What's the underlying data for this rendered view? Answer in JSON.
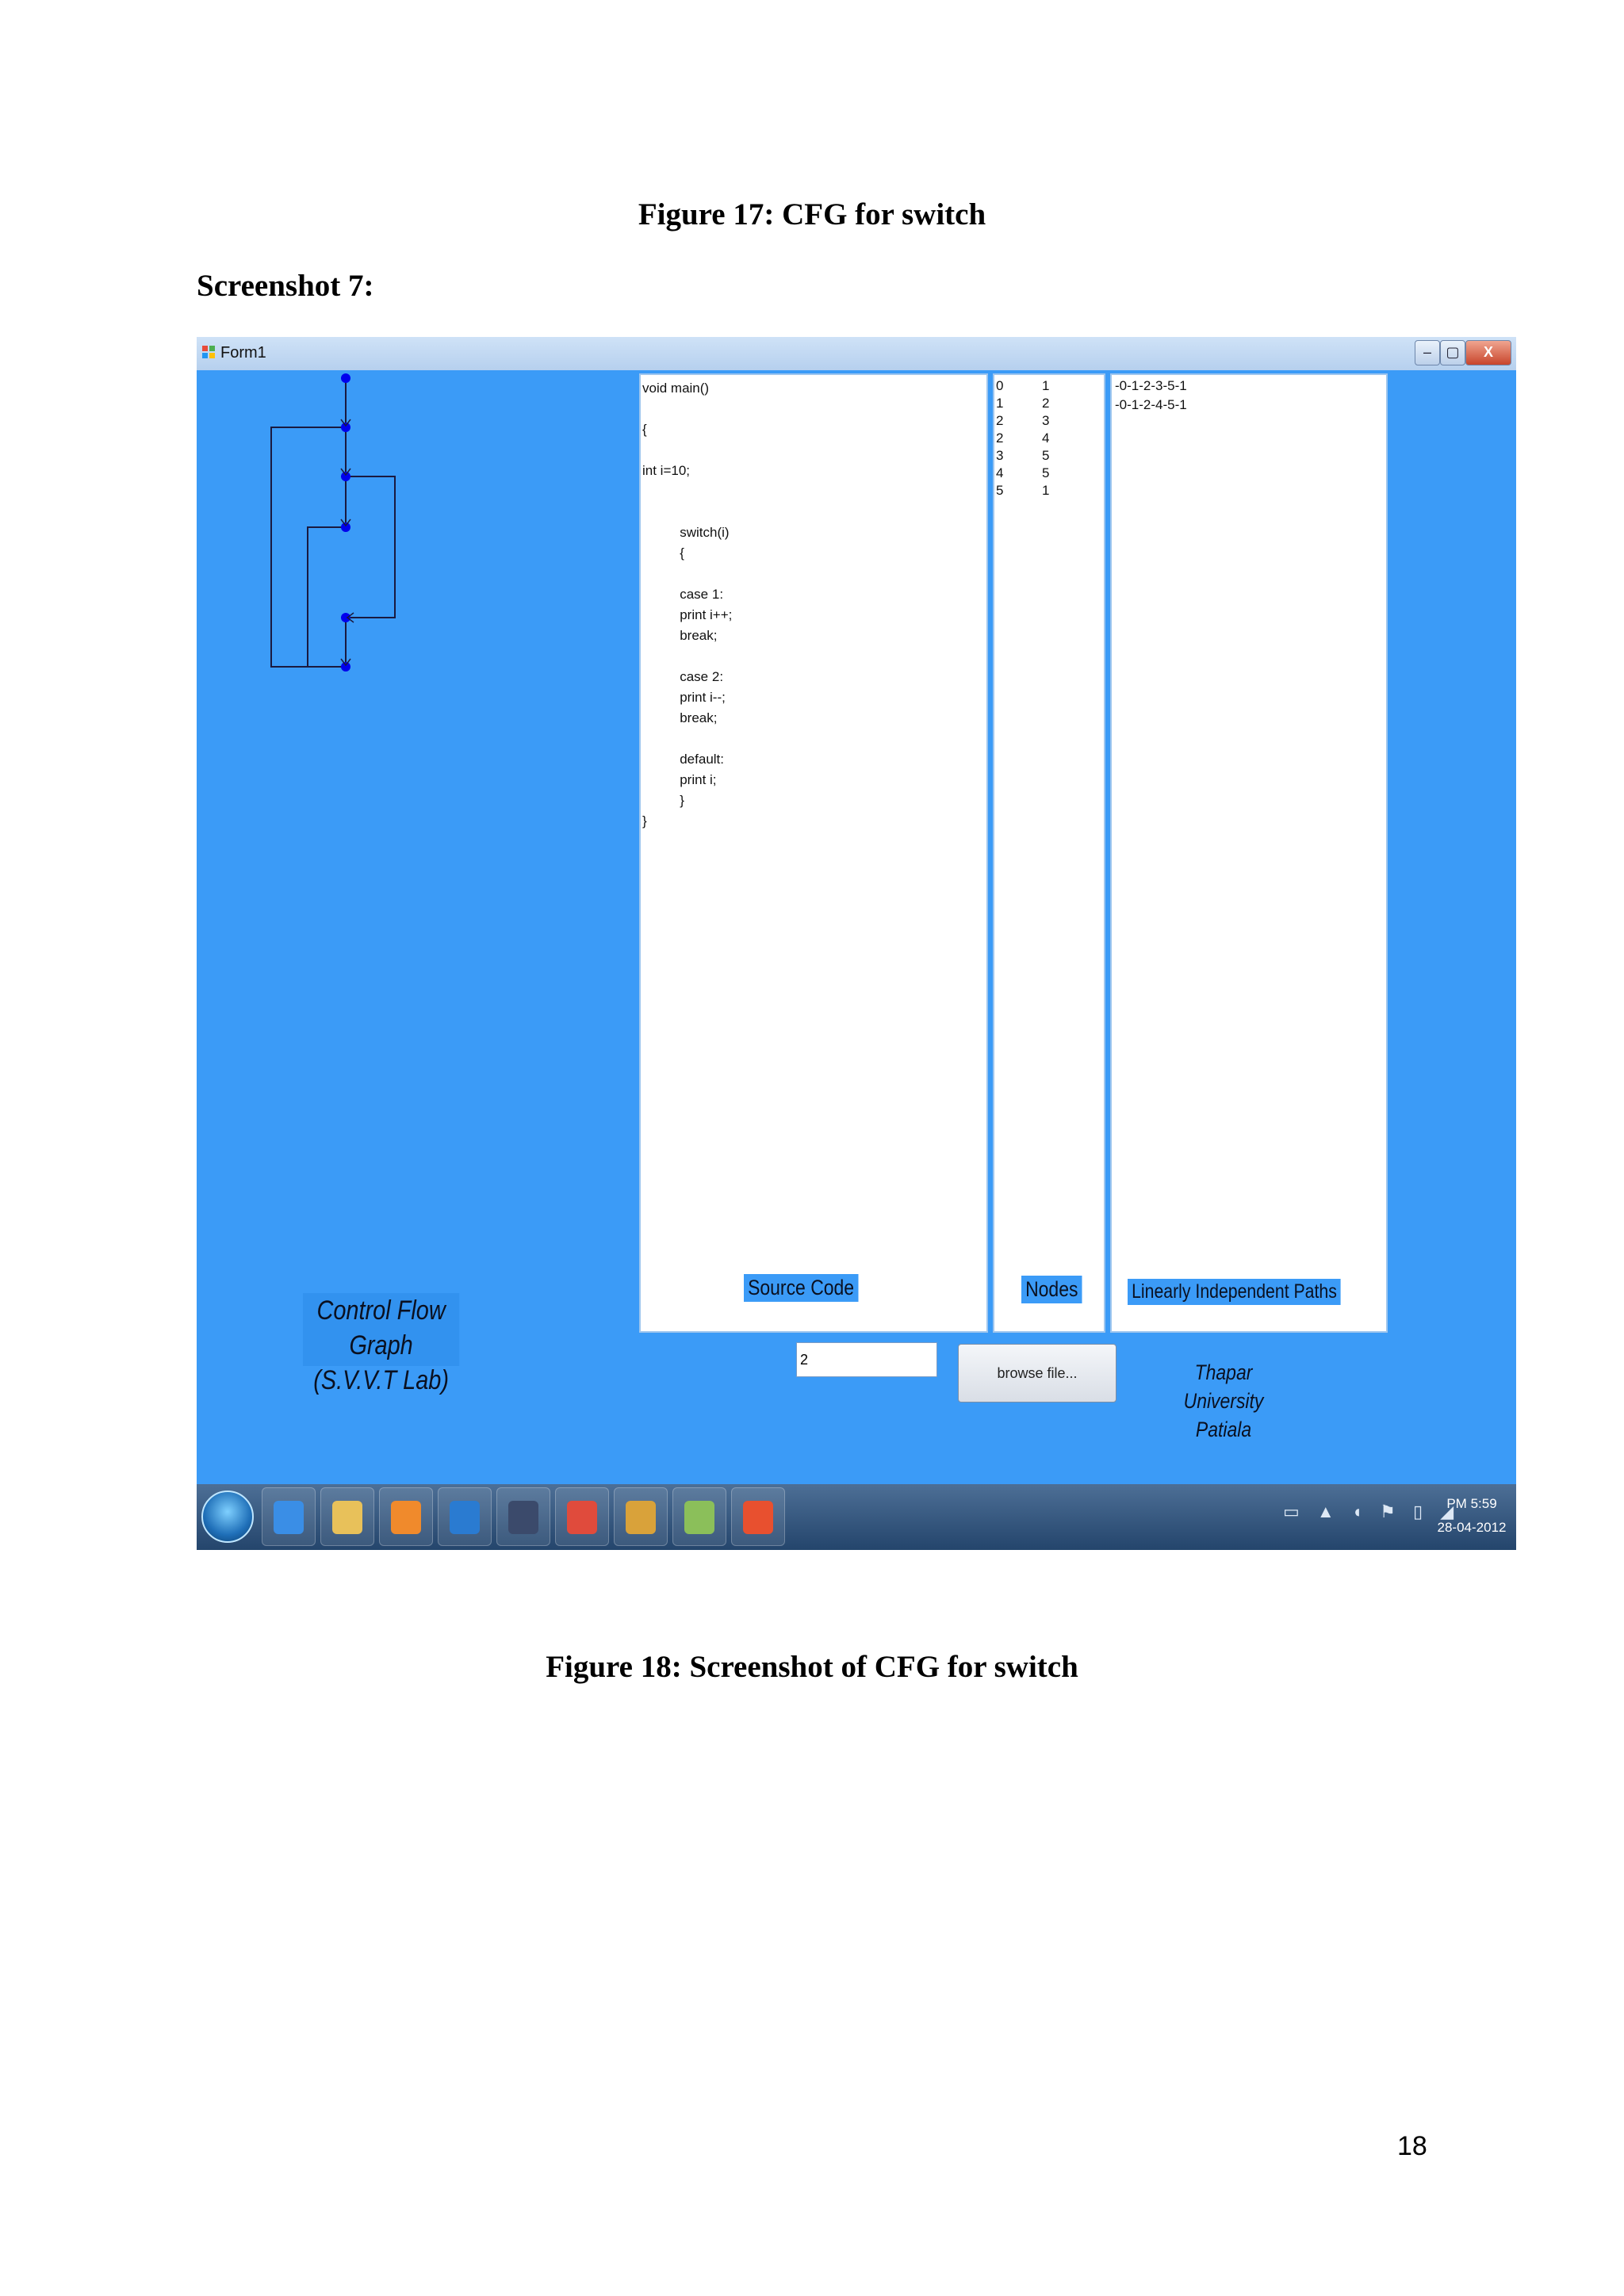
{
  "document": {
    "figure17_caption": "Figure 17: CFG for switch",
    "screenshot_label": "Screenshot 7:",
    "figure18_caption": "Figure 18: Screenshot of CFG for switch",
    "page_number": "18"
  },
  "window": {
    "title": "Form1",
    "minimize_label": "–",
    "maximize_label": "▢",
    "close_label": "X"
  },
  "source_code": {
    "text": "void main()\n\n{\n\nint i=10;\n\n\n          switch(i)\n          {\n\n          case 1:\n          print i++;\n          break;\n\n          case 2:\n          print i--;\n          break;\n\n          default:\n          print i;\n          }\n}",
    "label": "Source Code"
  },
  "nodes": {
    "label": "Nodes",
    "edges": [
      {
        "from": "0",
        "to": "1"
      },
      {
        "from": "1",
        "to": "2"
      },
      {
        "from": "2",
        "to": "3"
      },
      {
        "from": "2",
        "to": "4"
      },
      {
        "from": "3",
        "to": "5"
      },
      {
        "from": "4",
        "to": "5"
      },
      {
        "from": "5",
        "to": "1"
      }
    ]
  },
  "paths": {
    "label": "Linearly Independent Paths",
    "items": [
      "-0-1-2-3-5-1",
      "-0-1-2-4-5-1"
    ]
  },
  "cfg_title": {
    "line1": "Control Flow Graph",
    "line2": "(S.V.V.T Lab)"
  },
  "input": {
    "value": "2"
  },
  "browse_button": {
    "label": "browse file..."
  },
  "university": {
    "line1": "Thapar University",
    "line2": "Patiala"
  },
  "taskbar": {
    "apps": [
      "internet-explorer-icon",
      "file-explorer-icon",
      "media-player-icon",
      "dell-icon",
      "terminal-icon",
      "chrome-icon",
      "paint-app-icon",
      "paintbrush-icon",
      "windows-flag-icon"
    ],
    "clock_time": "PM 5:59",
    "clock_date": "28-04-2012"
  },
  "colors": {
    "form_background": "#3b9bf7",
    "graph_node": "#0000ee",
    "graph_edge": "#1a1a40"
  }
}
